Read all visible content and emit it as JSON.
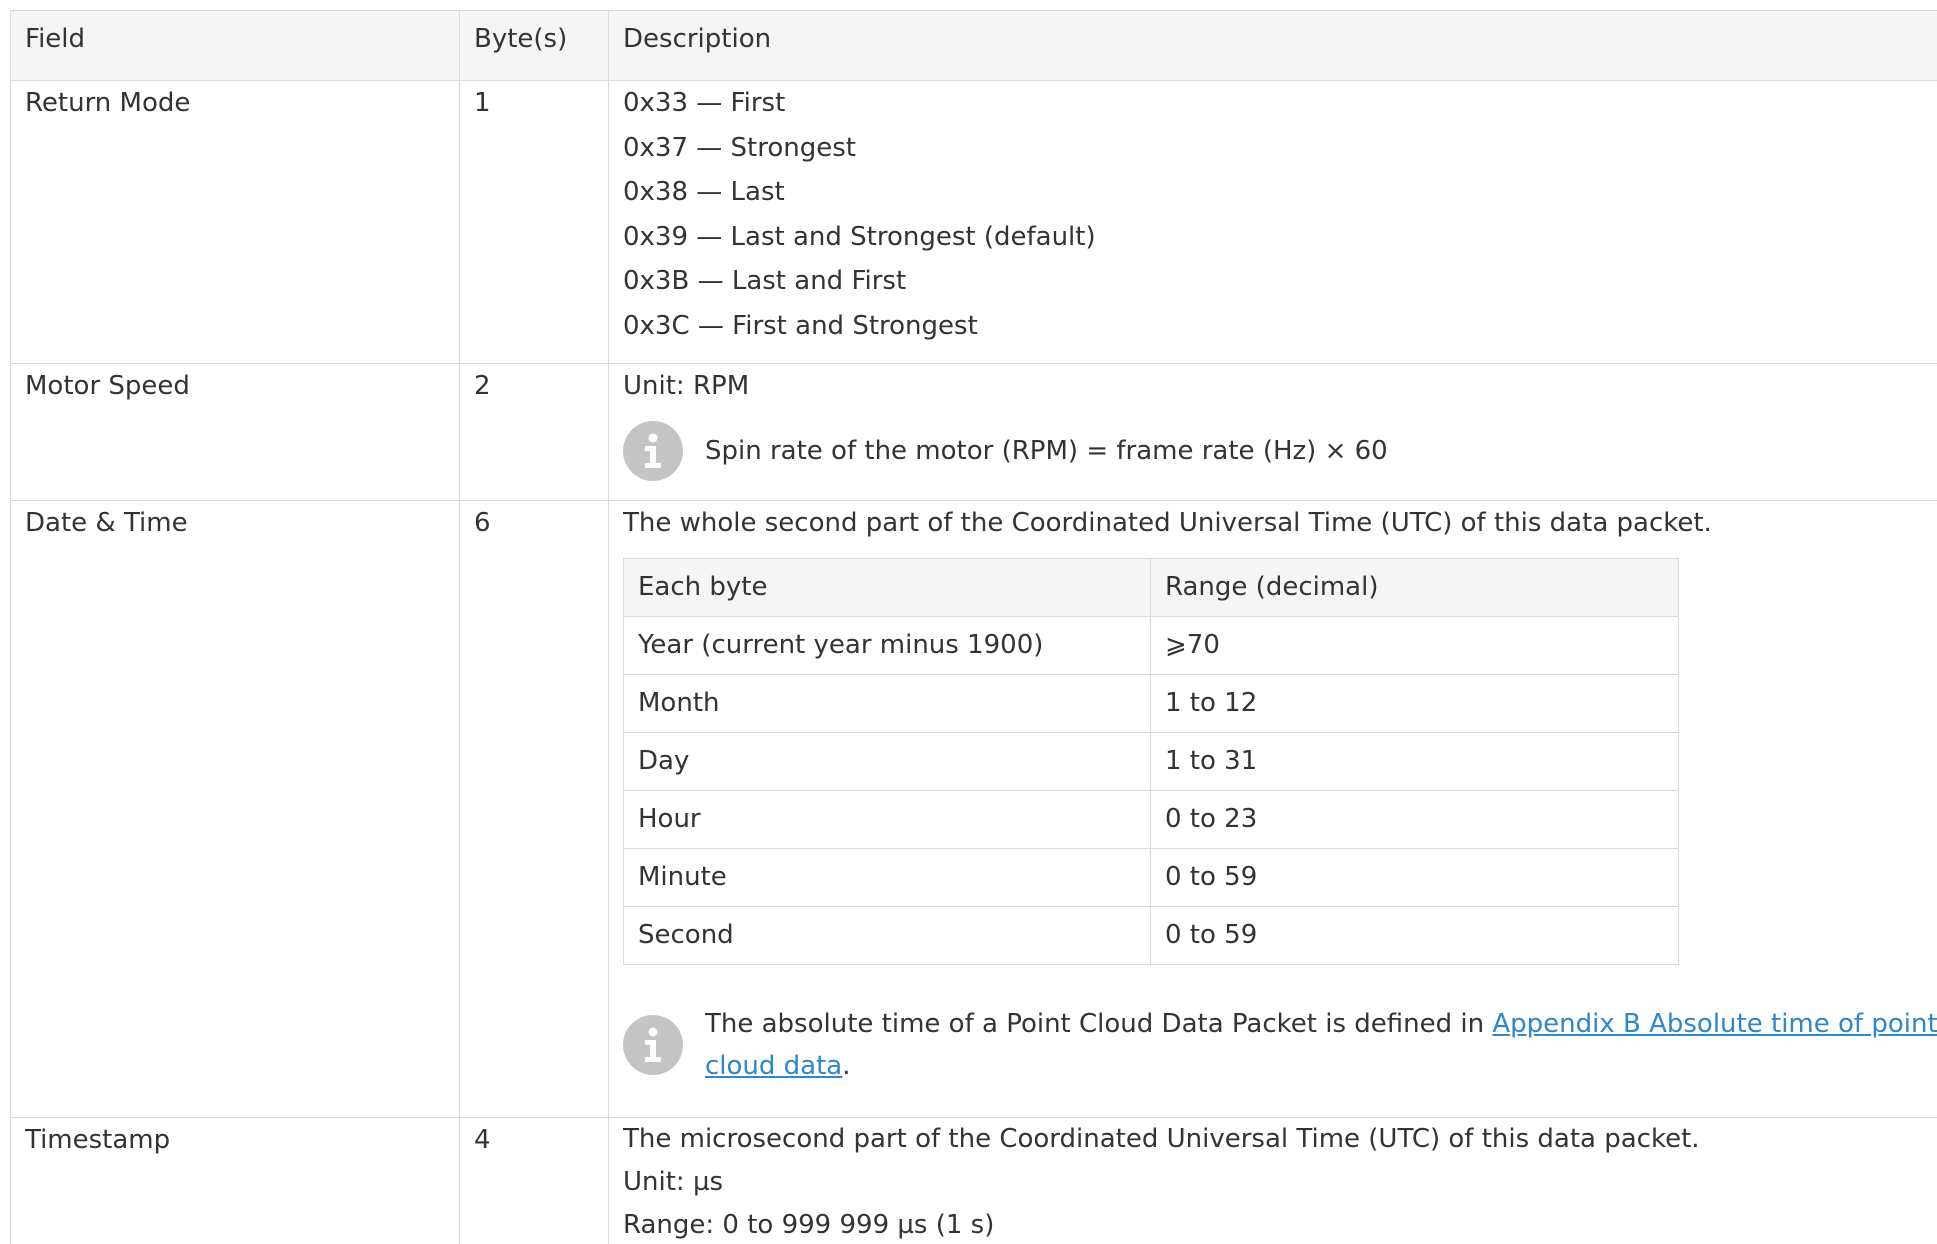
{
  "table": {
    "headers": [
      "Field",
      "Byte(s)",
      "Description"
    ],
    "rows": {
      "return_mode": {
        "field": "Return Mode",
        "bytes": "1",
        "options": [
          "0x33 — First",
          "0x37 — Strongest",
          "0x38 — Last",
          "0x39 — Last and Strongest (default)",
          "0x3B — Last and First",
          "0x3C — First and Strongest"
        ]
      },
      "motor_speed": {
        "field": "Motor Speed",
        "bytes": "2",
        "unit": "Unit: RPM",
        "note": "Spin rate of the motor (RPM) = frame rate (Hz) × 60"
      },
      "date_time": {
        "field": "Date & Time",
        "bytes": "6",
        "description": "The whole second part of the Coordinated Universal Time (UTC) of this data packet.",
        "inner_headers": [
          "Each byte",
          "Range (decimal)"
        ],
        "inner_rows": [
          [
            "Year (current year minus 1900)",
            "⩾70"
          ],
          [
            "Month",
            "1 to 12"
          ],
          [
            "Day",
            "1 to 31"
          ],
          [
            "Hour",
            "0 to 23"
          ],
          [
            "Minute",
            "0 to 59"
          ],
          [
            "Second",
            "0 to 59"
          ]
        ],
        "note_prefix": "The absolute time of a Point Cloud Data Packet is defined in ",
        "note_link": "Appendix B Absolute time of point cloud data",
        "note_suffix": "."
      },
      "timestamp": {
        "field": "Timestamp",
        "bytes": "4",
        "lines": [
          "The microsecond part of the Coordinated Universal Time (UTC) of this data packet.",
          "Unit: µs",
          "Range: 0 to 999 999 µs (1 s)"
        ]
      }
    }
  },
  "icons": {
    "note_icon": "info-icon"
  },
  "colors": {
    "text": "#333333",
    "border": "#d9d9d9",
    "header_bg": "#f5f5f5",
    "icon_bg": "#c4c4c4",
    "link": "#2f86c9"
  }
}
